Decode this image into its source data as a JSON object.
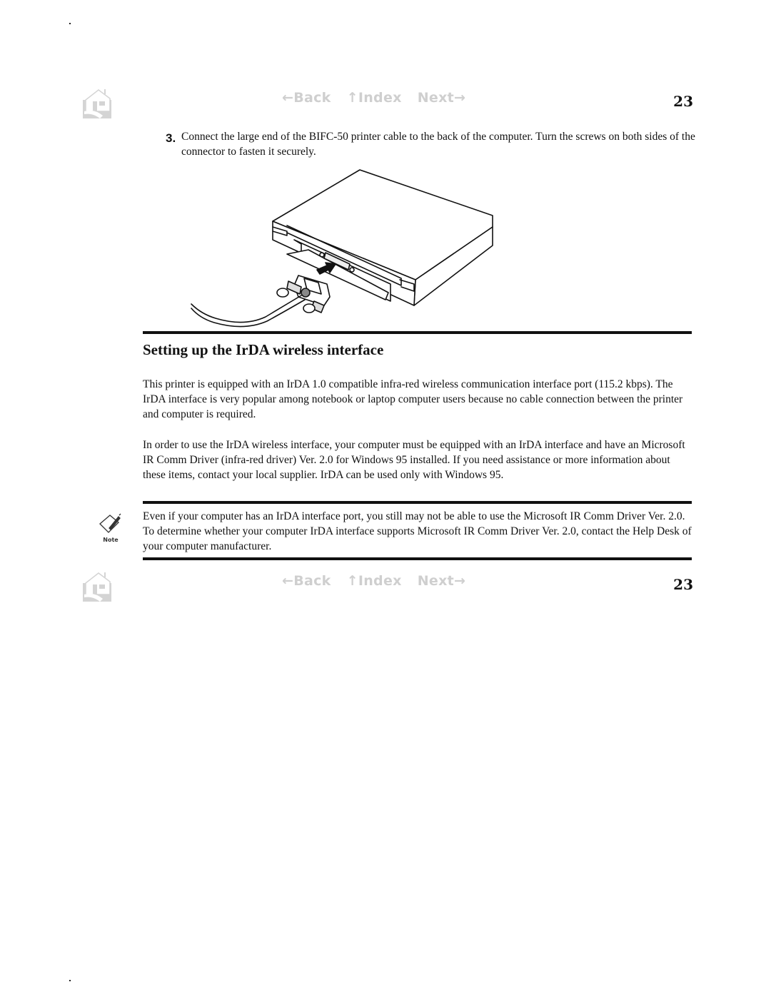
{
  "top_nav": {
    "home_icon": "home-icon",
    "back_label": "←Back",
    "index_label": "↑Index",
    "next_label": "Next→",
    "page_number": "23"
  },
  "step": {
    "number": "3.",
    "text": "Connect the large end of the BIFC-50 printer cable to the back of the computer. Turn the screws on both sides of the connector to fasten it securely."
  },
  "illustration": {
    "description": "computer-with-printer-cable-connector-illustration"
  },
  "section": {
    "heading": "Setting up the IrDA wireless interface",
    "paragraphs": [
      "This printer is equipped with an IrDA 1.0 compatible infra-red wireless communication interface port (115.2 kbps). The IrDA interface is very popular among notebook or laptop computer users because no cable connection between the printer and computer is required.",
      "In order to use the IrDA wireless interface, your computer must be equipped with an IrDA interface and have an Microsoft IR Comm Driver (infra-red driver) Ver. 2.0 for Windows 95 installed. If you need assistance or more information about these items, contact your local supplier. IrDA can be used only with Windows 95."
    ]
  },
  "note": {
    "icon_label": "Note",
    "text": "Even if your computer has an IrDA interface port, you still may not be able to use the Microsoft IR Comm Driver Ver. 2.0. To determine whether your computer IrDA interface supports Microsoft IR Comm Driver Ver. 2.0, contact the Help Desk of your computer manufacturer."
  },
  "bottom_nav": {
    "home_icon": "home-icon",
    "back_label": "←Back",
    "index_label": "↑Index",
    "next_label": "Next→",
    "page_number": "23"
  }
}
